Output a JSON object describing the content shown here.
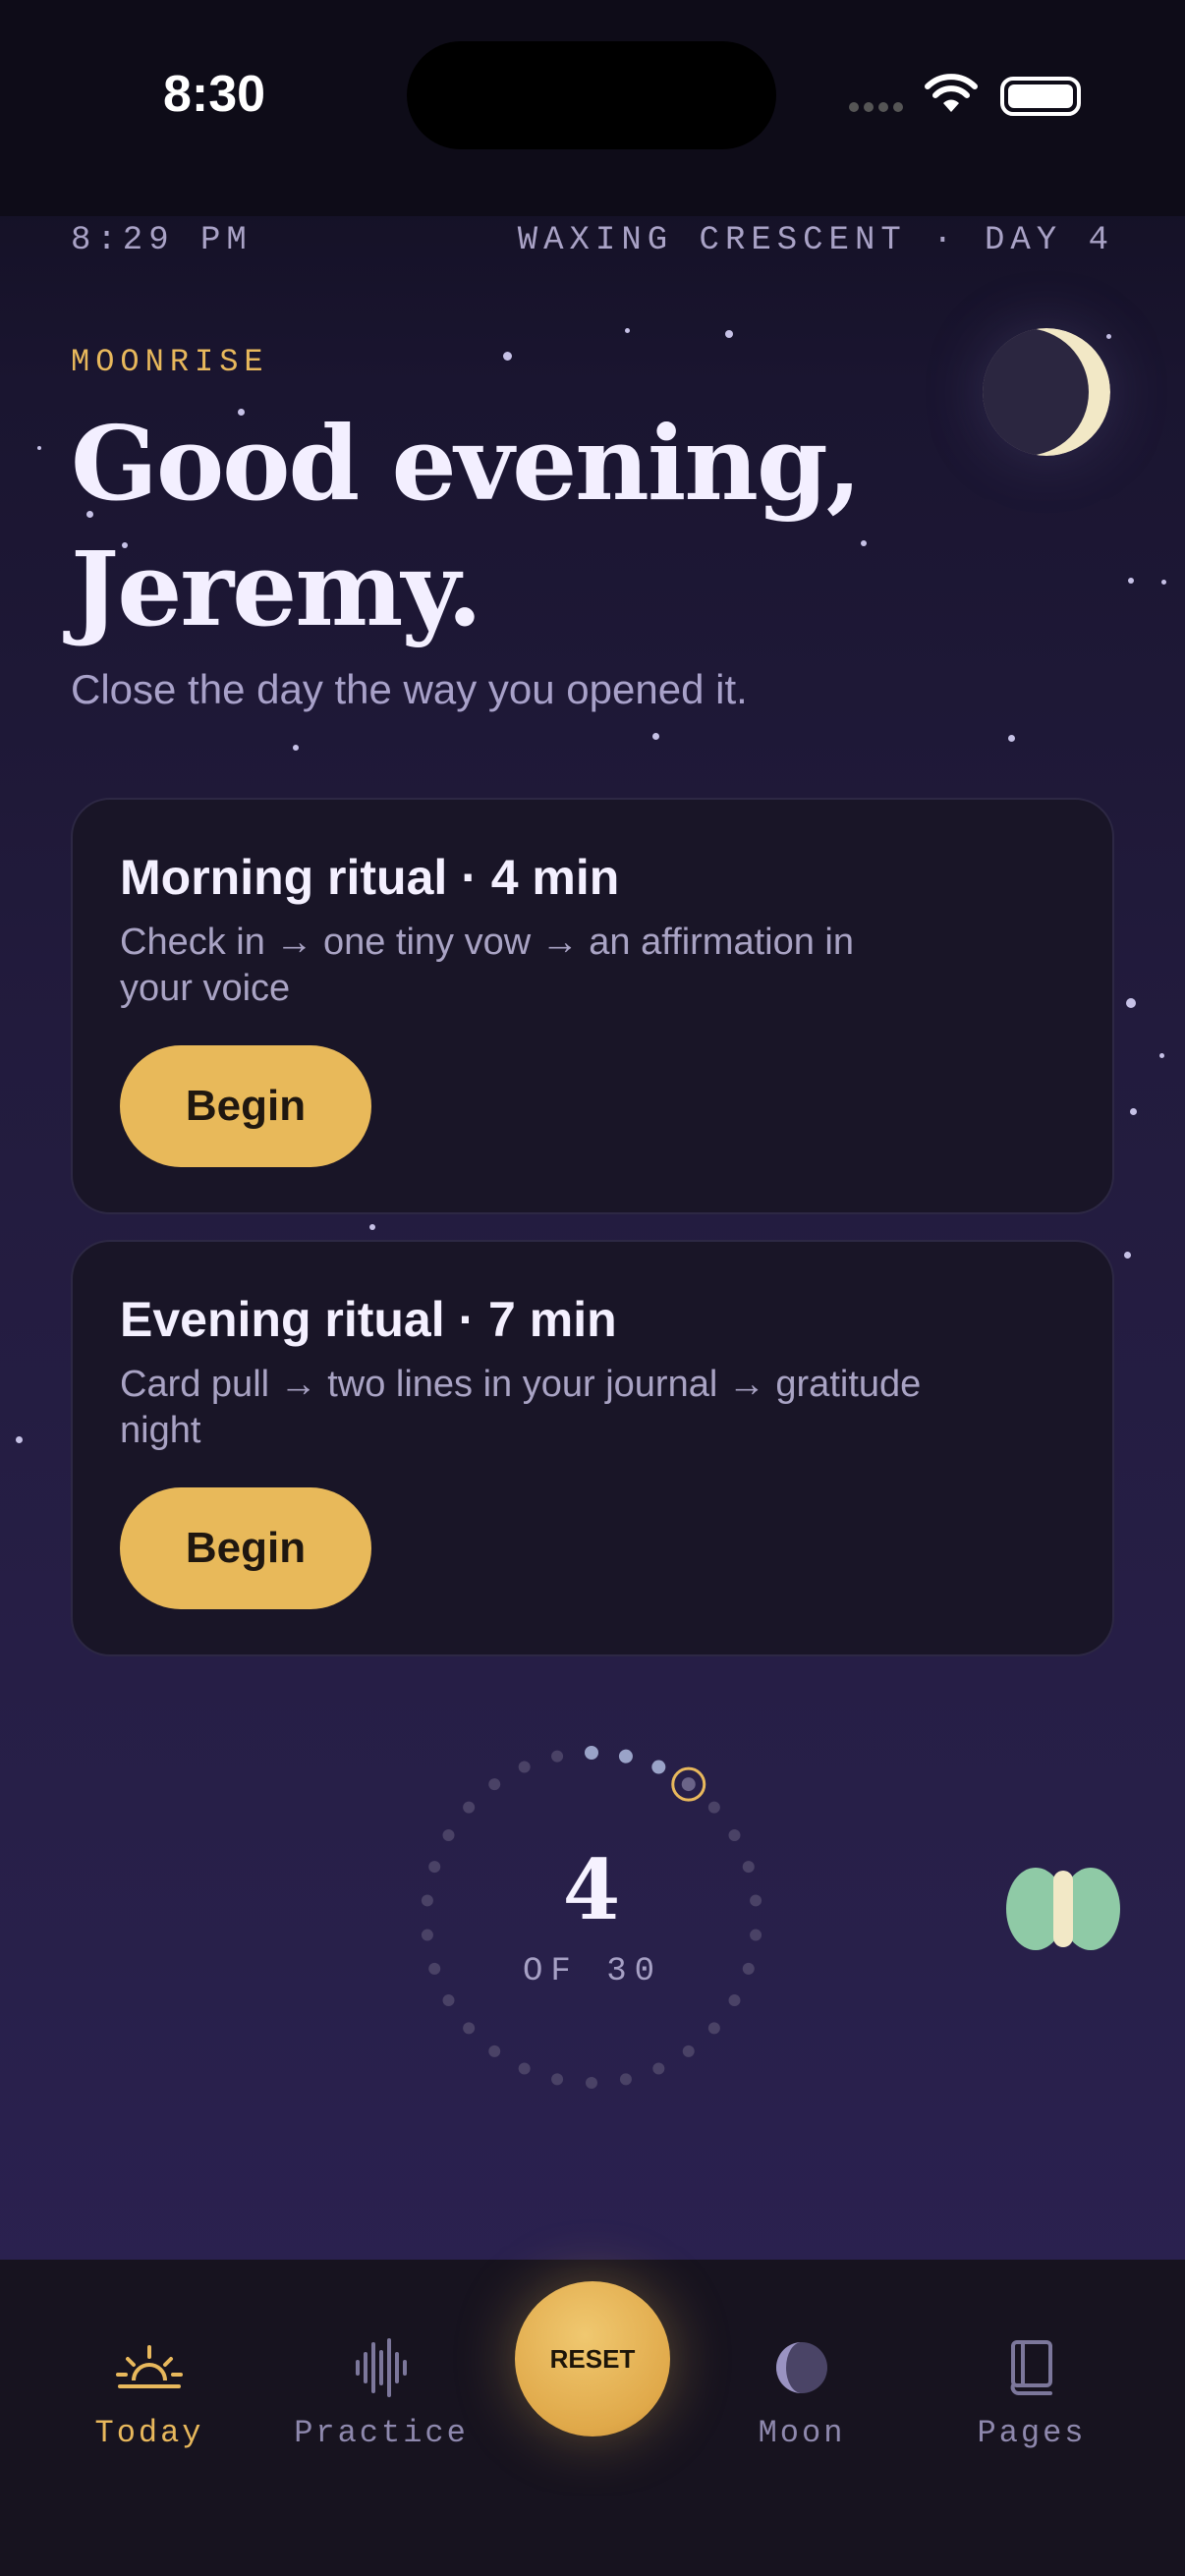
{
  "status_bar": {
    "time": "8:30"
  },
  "header": {
    "time": "8:29 PM",
    "phase": "WAXING CRESCENT · DAY 4"
  },
  "hero": {
    "eyebrow": "MOONRISE",
    "greeting_line1": "Good evening,",
    "greeting_line2": "Jeremy.",
    "subtitle": "Close the day the way you opened it."
  },
  "rituals": [
    {
      "title": "Morning ritual · 4 min",
      "description": "Check in → one tiny vow → an affirmation in your voice",
      "button": "Begin"
    },
    {
      "title": "Evening ritual · 7 min",
      "description": "Card pull → two lines in your journal → gratitude night",
      "button": "Begin"
    }
  ],
  "progress": {
    "current": "4",
    "of_label": "OF 30",
    "value": 4,
    "total": 30
  },
  "tabs": [
    {
      "label": "Today",
      "icon": "sunrise-icon",
      "active": true
    },
    {
      "label": "Practice",
      "icon": "waveform-icon",
      "active": false
    },
    {
      "label": "RESET",
      "icon": "reset-button",
      "active": false
    },
    {
      "label": "Moon",
      "icon": "moon-icon",
      "active": false
    },
    {
      "label": "Pages",
      "icon": "book-icon",
      "active": false
    }
  ],
  "colors": {
    "accent": "#e8b85c",
    "card": "#191527",
    "background": "#221b3d"
  }
}
